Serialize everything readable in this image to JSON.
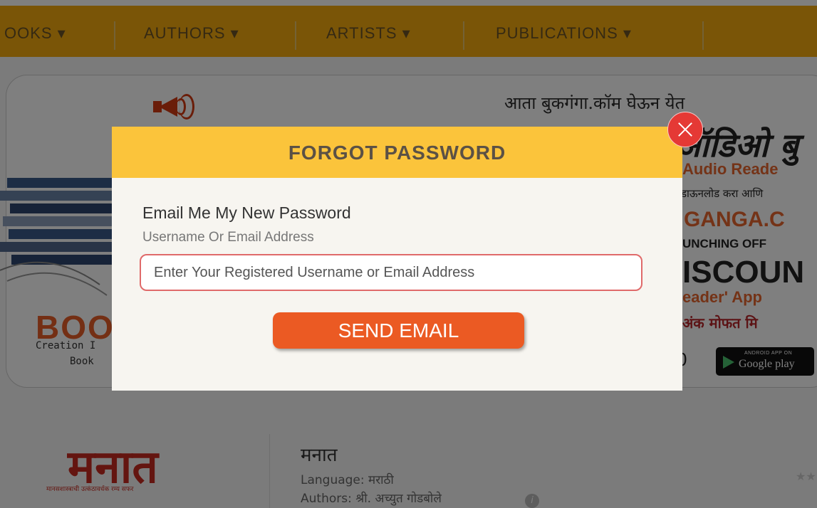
{
  "nav": {
    "items": [
      {
        "label": "OOKS ▾"
      },
      {
        "label": "AUTHORS ▾"
      },
      {
        "label": "ARTISTS ▾"
      },
      {
        "label": "PUBLICATIONS ▾"
      }
    ]
  },
  "banner": {
    "line_top": "आता बुकगंगा.कॉम घेऊन येत",
    "line_big": "ऑडिओ बु",
    "audio_reader": "Audio Reade",
    "download": "डाऊनलोड करा आणि",
    "ganga": "GANGA.C",
    "launching": "UNCHING OFF",
    "discount": "ISCOUN",
    "reader_app": "eader' App",
    "free": "अंक मोफत मि",
    "brand": "BOO",
    "creation": "Creation I",
    "book": "Book",
    "zero": "0",
    "google_play_small": "ANDROID APP ON",
    "google_play_big": "Google play"
  },
  "product": {
    "cover_title": "मनात",
    "cover_subtitle": "मानसशास्त्राची उत्कंठावर्धक रम्य सफर",
    "title": "मनात",
    "language": "Language: मराठी",
    "authors": "Authors: श्री. अच्युत गोडबोले",
    "info_icon": "i",
    "stars": "★★"
  },
  "modal": {
    "title": "FORGOT PASSWORD",
    "heading": "Email Me My New Password",
    "field_label": "Username Or Email Address",
    "input_placeholder": "Enter Your Registered Username or Email Address",
    "input_value": "",
    "submit_label": "SEND EMAIL",
    "close_icon": "close-icon"
  },
  "colors": {
    "nav_bg": "#f5ab0f",
    "modal_header": "#fbc43b",
    "send_button": "#eb5a23",
    "close_button": "#e53935",
    "input_border": "#e06a6a"
  }
}
